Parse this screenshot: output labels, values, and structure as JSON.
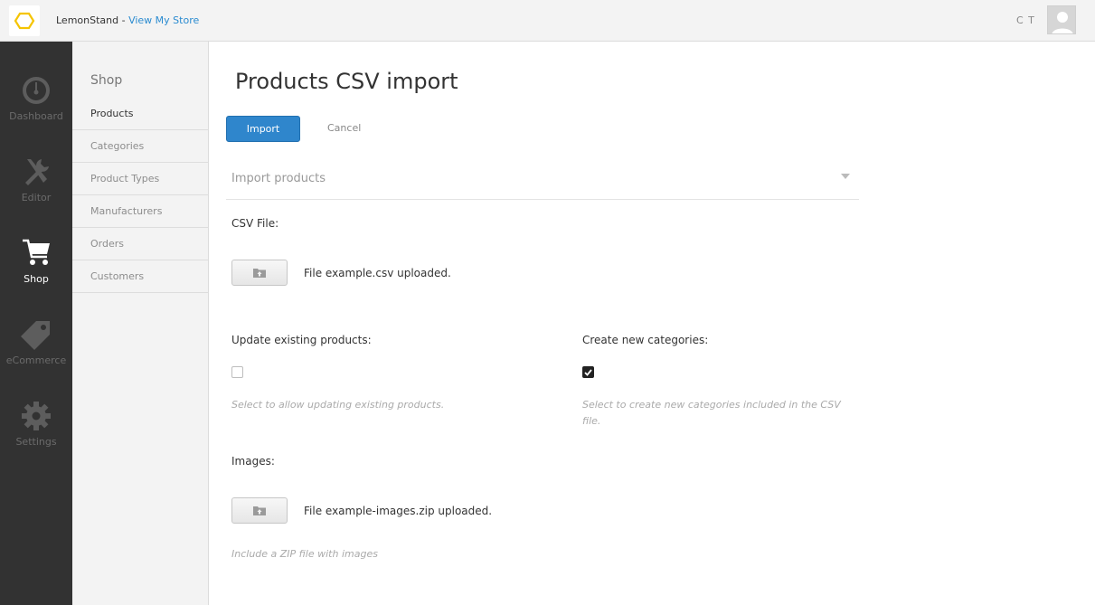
{
  "topbar": {
    "brand": "LemonStand -",
    "store_link": "View My Store",
    "user_initials": "C T"
  },
  "nav": {
    "items": [
      {
        "label": "Dashboard",
        "icon": "dashboard-icon"
      },
      {
        "label": "Editor",
        "icon": "tools-icon"
      },
      {
        "label": "Shop",
        "icon": "cart-icon"
      },
      {
        "label": "eCommerce",
        "icon": "tag-icon"
      },
      {
        "label": "Settings",
        "icon": "gear-icon"
      }
    ],
    "active": "Shop"
  },
  "subnav": {
    "title": "Shop",
    "items": [
      {
        "label": "Products"
      },
      {
        "label": "Categories"
      },
      {
        "label": "Product Types"
      },
      {
        "label": "Manufacturers"
      },
      {
        "label": "Orders"
      },
      {
        "label": "Customers"
      }
    ],
    "active": "Products"
  },
  "main": {
    "title": "Products CSV import",
    "import_label": "Import",
    "cancel_label": "Cancel",
    "section_title": "Import products",
    "csv_label": "CSV File:",
    "csv_status": "File example.csv uploaded.",
    "update_label": "Update existing products:",
    "update_hint": "Select to allow updating existing products.",
    "update_checked": false,
    "create_label": "Create new categories:",
    "create_hint": "Select to create new categories included in the CSV file.",
    "create_checked": true,
    "images_label": "Images:",
    "images_status": "File example-images.zip uploaded.",
    "images_hint": "Include a ZIP file with images"
  },
  "colors": {
    "primary": "#2f86cc",
    "link": "#2a8bd0",
    "nav_bg": "#323232",
    "logo_yellow": "#f5c400"
  }
}
